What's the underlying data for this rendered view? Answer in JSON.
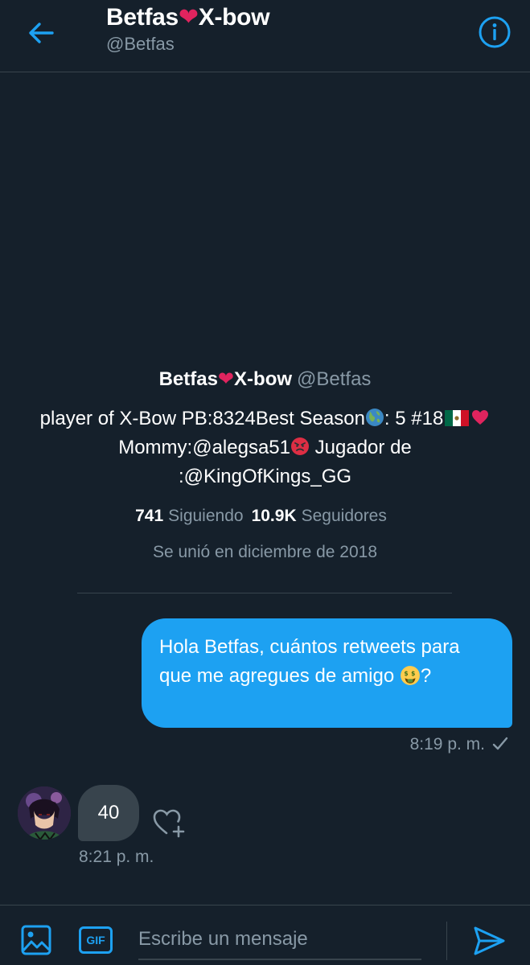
{
  "header": {
    "title_before": "Betfas",
    "title_heart": "❤",
    "title_after": "X-bow",
    "subtitle": "@Betfas"
  },
  "profile": {
    "name_before": "Betfas",
    "name_heart": "❤",
    "name_after": "X-bow",
    "handle": "@Betfas",
    "bio_part1": "player of X-Bow PB:8324Best Season",
    "bio_part2": ": 5 #18",
    "bio_part3": " Mommy:@alegsa51",
    "bio_part4": " Jugador de :@KingOfKings_GG",
    "following_count": "741",
    "following_label": "Siguiendo",
    "followers_count": "10.9K",
    "followers_label": "Seguidores",
    "joined": "Se unió en diciembre de 2018"
  },
  "messages": {
    "sent": {
      "text": "Hola Betfas, cuántos retweets para que me agregues de amigo ",
      "suffix": "?",
      "time": "8:19 p. m."
    },
    "received": {
      "text": "40",
      "time": "8:21 p. m."
    }
  },
  "composer": {
    "placeholder": "Escribe un mensaje",
    "gif_label": "GIF"
  },
  "icons": {
    "back": "arrow-left-icon",
    "info": "info-icon",
    "image": "image-icon",
    "send": "send-icon",
    "like": "heart-plus-icon",
    "check": "check-icon"
  },
  "colors": {
    "background": "#15202b",
    "accent": "#1da1f2",
    "secondary_text": "#8899a6",
    "border": "#38444d",
    "heart": "#e0245e"
  }
}
